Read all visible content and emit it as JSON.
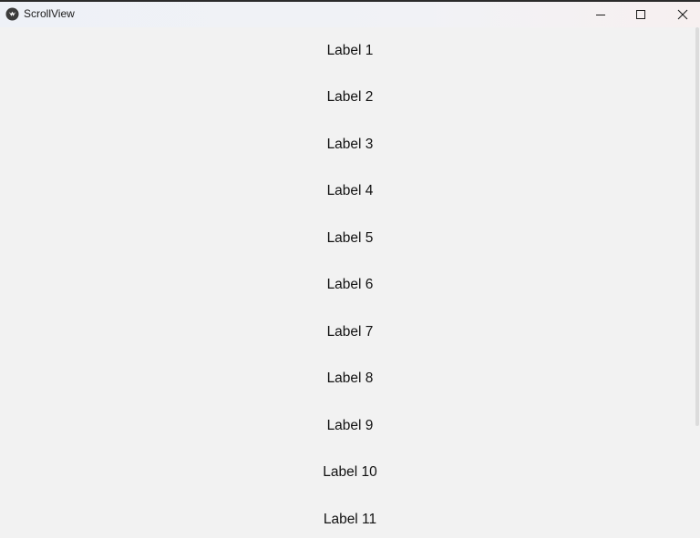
{
  "window": {
    "title": "ScrollView",
    "app_icon": "kivy-logo-icon",
    "controls": {
      "minimize_icon": "minimize-icon",
      "maximize_icon": "maximize-icon",
      "close_icon": "close-icon"
    }
  },
  "scroll": {
    "labels": [
      "Label 1",
      "Label 2",
      "Label 3",
      "Label 4",
      "Label 5",
      "Label 6",
      "Label 7",
      "Label 8",
      "Label 9",
      "Label 10",
      "Label 11"
    ]
  },
  "colors": {
    "background": "#f2f2f2",
    "text": "#111111"
  }
}
